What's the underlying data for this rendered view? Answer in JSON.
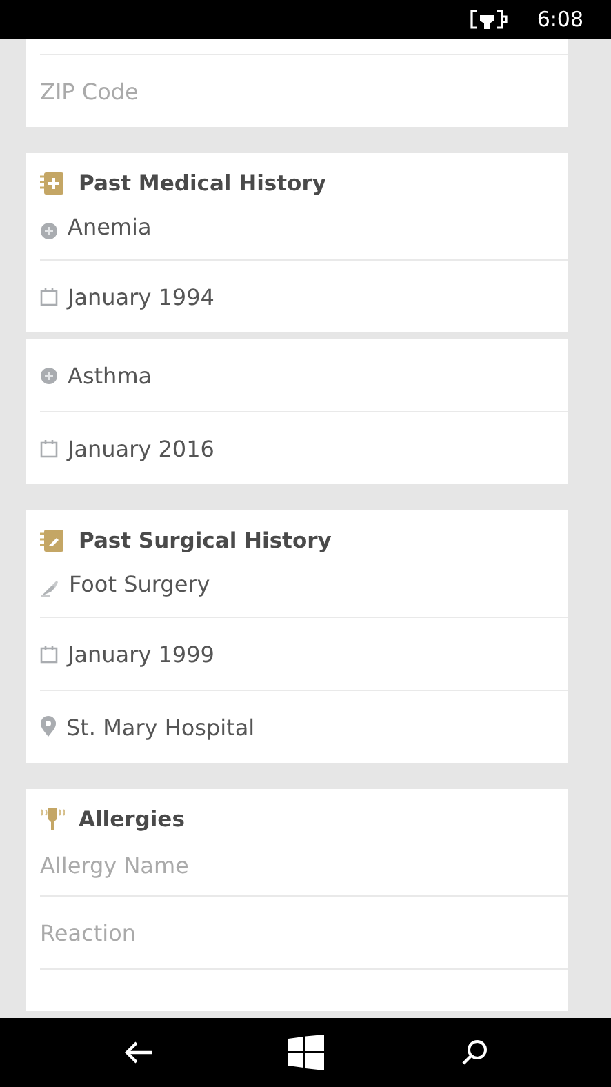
{
  "status_bar": {
    "charging": true,
    "time": "6:08"
  },
  "cards": [
    {
      "rows": [
        {
          "kind": "input",
          "placeholder": "ZIP Code"
        }
      ]
    },
    {
      "header": {
        "kind": "medical",
        "title": "Past Medical History"
      },
      "rows": [
        {
          "kind": "condition",
          "text": "Anemia"
        },
        {
          "kind": "date",
          "text": "January 1994"
        }
      ]
    },
    {
      "rows": [
        {
          "kind": "condition",
          "text": "Asthma"
        },
        {
          "kind": "date",
          "text": "January 2016"
        }
      ]
    },
    {
      "header": {
        "kind": "surgical",
        "title": "Past Surgical History"
      },
      "rows": [
        {
          "kind": "procedure",
          "text": "Foot Surgery"
        },
        {
          "kind": "date",
          "text": "January 1999"
        },
        {
          "kind": "place",
          "text": "St. Mary Hospital"
        }
      ]
    },
    {
      "header": {
        "kind": "allergy",
        "title": "Allergies"
      },
      "rows": [
        {
          "kind": "input",
          "placeholder": "Allergy Name"
        },
        {
          "kind": "input",
          "placeholder": "Reaction"
        }
      ]
    }
  ]
}
